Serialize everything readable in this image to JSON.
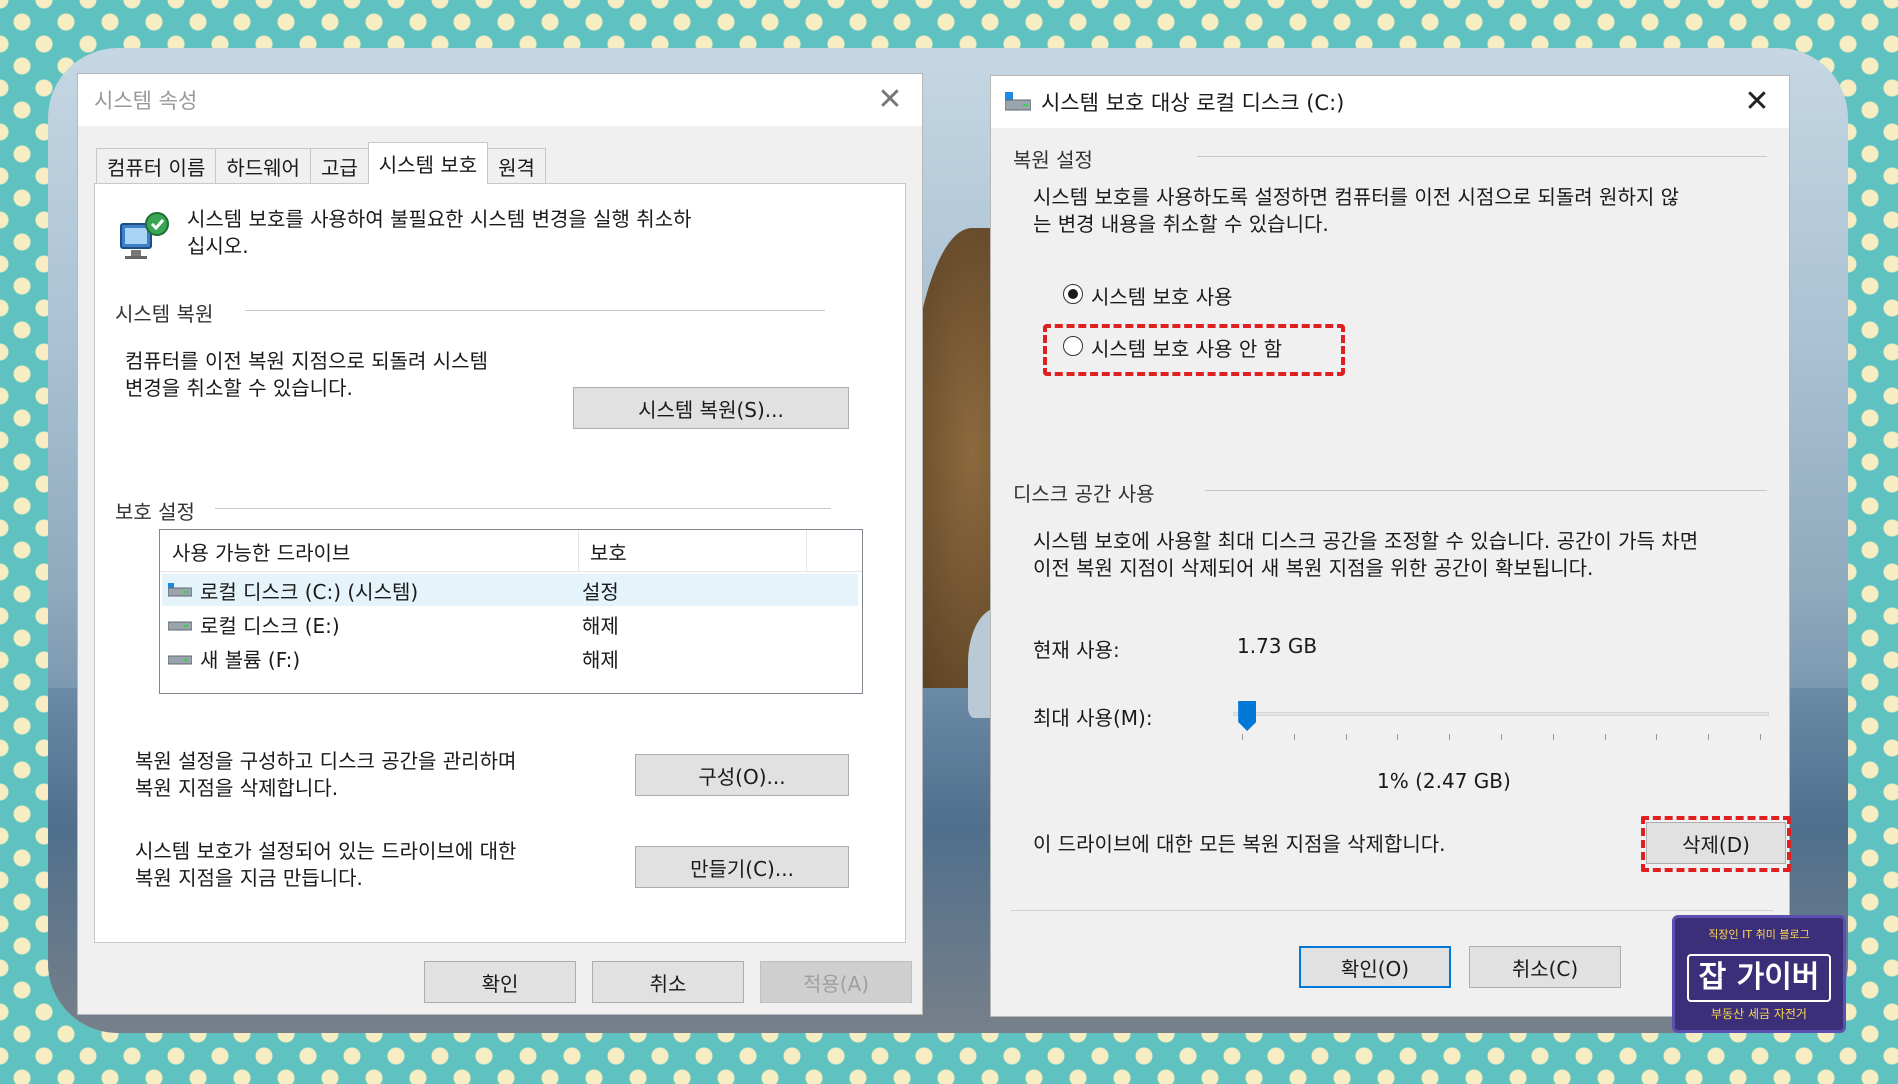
{
  "left_window": {
    "title": "시스템 속성",
    "tabs": [
      {
        "label": "컴퓨터 이름"
      },
      {
        "label": "하드웨어"
      },
      {
        "label": "고급"
      },
      {
        "label": "시스템 보호"
      },
      {
        "label": "원격"
      }
    ],
    "active_tab": "시스템 보호",
    "intro_text": "시스템 보호를 사용하여 불필요한 시스템 변경을 실행 취소하\n십시오.",
    "restore_group": {
      "label": "시스템 복원",
      "text": "컴퓨터를 이전 복원 지점으로 되돌려 시스템\n변경을 취소할 수 있습니다.",
      "button": "시스템 복원(S)..."
    },
    "protection_group": {
      "label": "보호 설정",
      "columns": [
        "사용 가능한 드라이브",
        "보호"
      ],
      "drives": [
        {
          "name": "로컬 디스크 (C:) (시스템)",
          "protection": "설정",
          "selected": true
        },
        {
          "name": "로컬 디스크 (E:)",
          "protection": "해제",
          "selected": false
        },
        {
          "name": "새 볼륨 (F:)",
          "protection": "해제",
          "selected": false
        }
      ],
      "configure_text": "복원 설정을 구성하고 디스크 공간을 관리하며\n복원 지점을 삭제합니다.",
      "configure_button": "구성(O)...",
      "create_text": "시스템 보호가 설정되어 있는 드라이브에 대한\n복원 지점을 지금 만듭니다.",
      "create_button": "만들기(C)..."
    },
    "footer": {
      "ok": "확인",
      "cancel": "취소",
      "apply": "적용(A)"
    }
  },
  "right_window": {
    "title": "시스템 보호 대상 로컬 디스크 (C:)",
    "restore_settings": {
      "label": "복원 설정",
      "text": "시스템 보호를 사용하도록 설정하면 컴퓨터를 이전 시점으로 되돌려 원하지 않\n는 변경 내용을 취소할 수 있습니다.",
      "option_on": "시스템 보호 사용",
      "option_off": "시스템 보호 사용 안 함",
      "selected": "시스템 보호 사용"
    },
    "disk_usage": {
      "label": "디스크 공간 사용",
      "text": "시스템 보호에 사용할 최대 디스크 공간을 조정할 수 있습니다. 공간이 가득 차면\n이전 복원 지점이 삭제되어 새 복원 지점을 위한 공간이 확보됩니다.",
      "current_label": "현재 사용:",
      "current_value": "1.73 GB",
      "max_label": "최대 사용(M):",
      "max_value": "1% (2.47 GB)",
      "slider_percent": 1,
      "delete_text": "이 드라이브에 대한 모든 복원 지점을 삭제합니다.",
      "delete_button": "삭제(D)"
    },
    "footer": {
      "ok": "확인(O)",
      "cancel": "취소(C)"
    }
  },
  "badge": {
    "top": "직장인 IT 취미 블로그",
    "main": "잡 가이버",
    "bottom": "부동산 세금 자전거"
  },
  "colors": {
    "accent": "#0078d7",
    "highlight_dashed": "#e02020",
    "background_teal": "#5fc2c0",
    "dots": "#f6eec2"
  }
}
